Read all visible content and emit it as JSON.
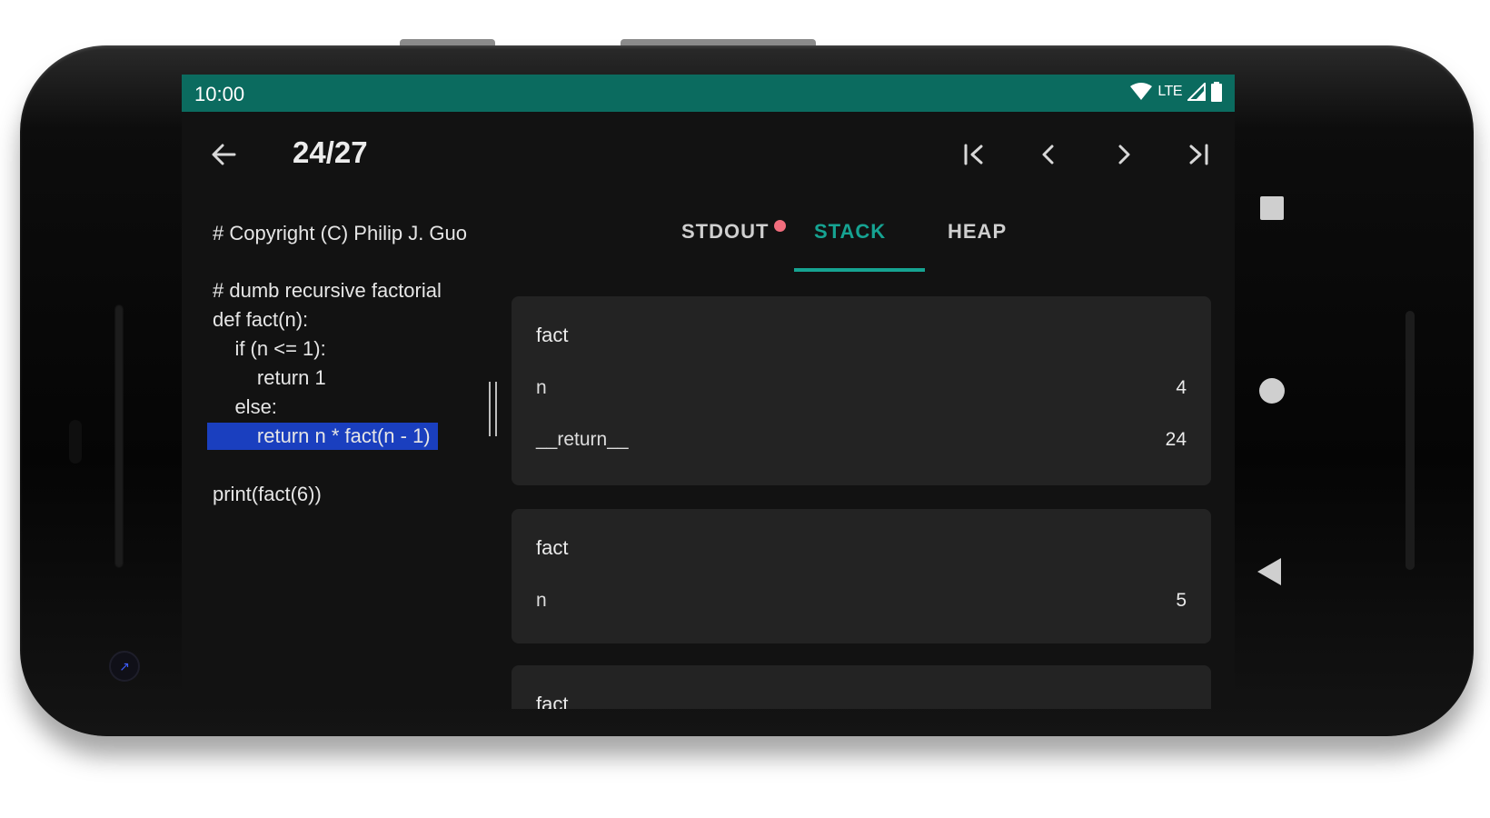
{
  "status_bar": {
    "time": "10:00",
    "network_label": "LTE",
    "color": "#0b6b5f"
  },
  "toolbar": {
    "step_counter": "24/27",
    "back_icon": "arrow-left-icon",
    "nav_icons": [
      "skip-first-icon",
      "chevron-left-icon",
      "chevron-right-icon",
      "skip-last-icon"
    ]
  },
  "code": {
    "lines": [
      "# Copyright (C) Philip J. Guo",
      "# dumb recursive factorial",
      "def fact(n):",
      "    if (n <= 1):",
      "        return 1",
      "    else:",
      "        return n * fact(n - 1)",
      "print(fact(6))"
    ],
    "highlighted_line_index": 6,
    "highlight_color": "#1a3fbf"
  },
  "tabs": {
    "items": [
      "STDOUT",
      "STACK",
      "HEAP"
    ],
    "active": "STACK",
    "accent_color": "#16a392",
    "stdout_badge_color": "#f26d7d"
  },
  "stack": {
    "frames": [
      {
        "name": "fact",
        "vars": [
          {
            "name": "n",
            "value": "4"
          },
          {
            "name": "__return__",
            "value": "24"
          }
        ]
      },
      {
        "name": "fact",
        "vars": [
          {
            "name": "n",
            "value": "5"
          }
        ]
      },
      {
        "name": "fact",
        "vars": []
      }
    ]
  },
  "system_nav": {
    "icons": [
      "recents-square-icon",
      "home-circle-icon",
      "back-triangle-icon"
    ]
  }
}
